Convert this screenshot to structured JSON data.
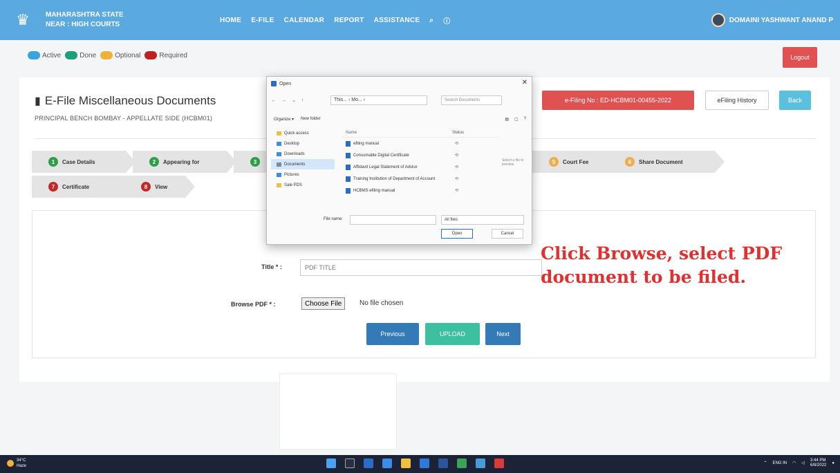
{
  "navbar": {
    "brand_line1": "MAHARASHTRA STATE",
    "brand_line2": "NEAR : HIGH COURTS",
    "links": [
      "HOME",
      "E-FILE",
      "CALENDAR",
      "REPORT",
      "ASSISTANCE"
    ],
    "user_name": "DOMAINI YASHWANT ANAND P"
  },
  "legend": {
    "items": [
      {
        "label": "Active",
        "color": "#3aa3e3"
      },
      {
        "label": "Done",
        "color": "#1aa07a"
      },
      {
        "label": "Optional",
        "color": "#f0b03a"
      },
      {
        "label": "Required",
        "color": "#c0201e"
      }
    ]
  },
  "header": {
    "logout_label": "Logout",
    "title": "E-File Miscellaneous Documents",
    "subtitle": "PRINCIPAL BENCH BOMBAY - APPELLATE SIDE (HCBM01)",
    "efiling_no": "e-Filing No : ED-HCBM01-00455-2022",
    "history_label": "eFiling History",
    "back_label": "Back"
  },
  "steps": [
    {
      "num": "1",
      "label": "Case Details",
      "state": "green"
    },
    {
      "num": "2",
      "label": "Appearing for",
      "state": "green"
    },
    {
      "num": "3",
      "label": "",
      "state": "green"
    },
    {
      "num": "5",
      "label": "Court Fee",
      "state": "orange"
    },
    {
      "num": "6",
      "label": "Share Document",
      "state": "orange"
    },
    {
      "num": "7",
      "label": "Certificate",
      "state": "red"
    },
    {
      "num": "8",
      "label": "View",
      "state": "red"
    }
  ],
  "form": {
    "title_label": "Title * :",
    "title_placeholder": "PDF TITLE",
    "browse_label": "Browse PDF * :",
    "choose_file_label": "Choose File",
    "no_file_text": "No file chosen",
    "previous_label": "Previous",
    "upload_label": "UPLOAD",
    "next_label": "Next"
  },
  "annotation": {
    "text": "Click Browse, select PDF document to be filed."
  },
  "dialog": {
    "title": "Open",
    "path": "This... › Mo... ›",
    "search_placeholder": "Search Documents",
    "organize": "Organize ▾",
    "new_folder": "New folder",
    "nav_items": [
      "Quick access",
      "Desktop",
      "Downloads",
      "Documents",
      "Pictures",
      "Sale PDS"
    ],
    "col_name": "Name",
    "col_status": "Status",
    "files": [
      "efiling manual",
      "Consumable Digital Certificate",
      "Affidavit Legal Statement of Advice",
      "Training Institution of Department of Account",
      "HCBMS efiling manual"
    ],
    "preview_text": "Select a file to preview.",
    "filename_label": "File name:",
    "filter": "All files",
    "open_label": "Open",
    "cancel_label": "Cancel"
  },
  "taskbar": {
    "weather_temp": "34°C",
    "weather_desc": "Haze",
    "tray_lang": "ENG IN",
    "tray_time": "3:44 PM",
    "tray_date": "6/8/2022"
  }
}
